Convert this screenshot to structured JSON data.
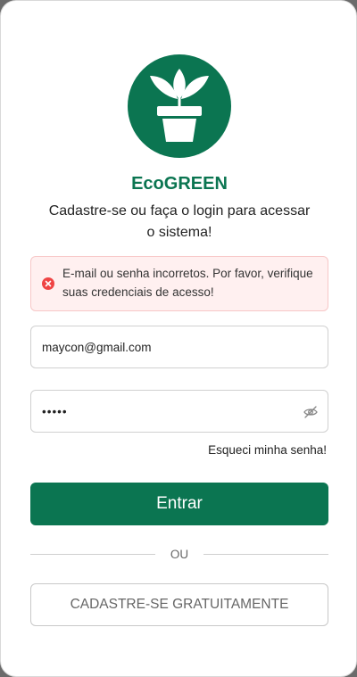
{
  "brand": {
    "name": "EcoGREEN",
    "logo_icon": "plant-pot-icon",
    "color": "#0b7551"
  },
  "subtitle": "Cadastre-se ou faça o login para acessar o sistema!",
  "alert": {
    "icon": "error-x-icon",
    "message": "E-mail ou senha incorretos. Por favor, verifique suas credenciais de acesso!",
    "color": "#ef4444"
  },
  "form": {
    "email_value": "maycon@gmail.com",
    "password_value": "•••••",
    "password_toggle_icon": "eye-off-icon",
    "forgot_label": "Esqueci minha senha!",
    "submit_label": "Entrar",
    "divider_label": "OU",
    "register_label": "CADASTRE-SE GRATUITAMENTE"
  }
}
